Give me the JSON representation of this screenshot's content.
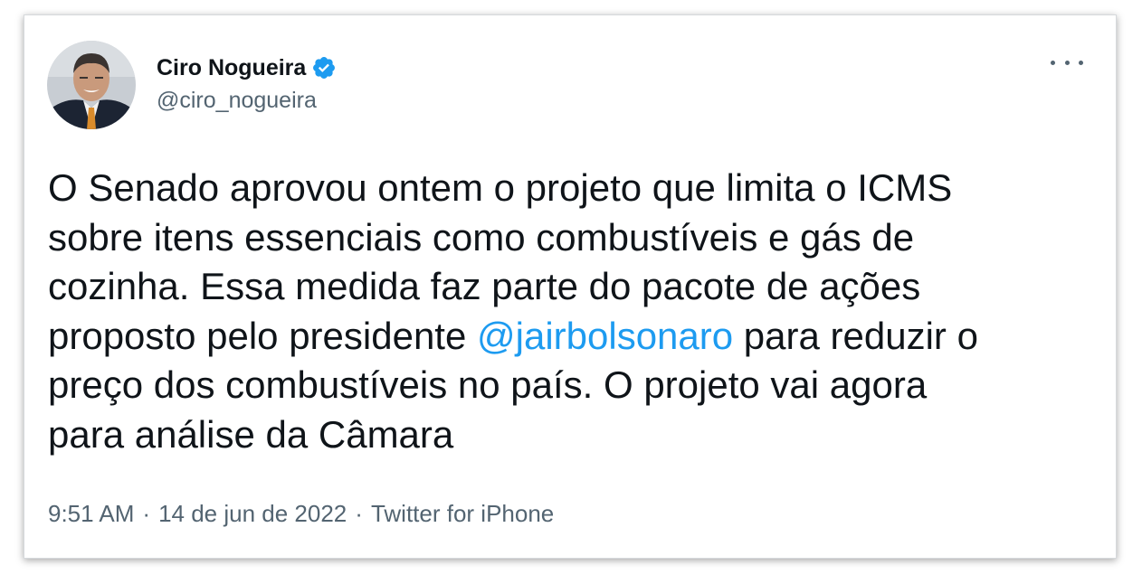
{
  "author": {
    "name": "Ciro Nogueira",
    "handle": "@ciro_nogueira",
    "verified": true,
    "avatar_icon": "profile-photo"
  },
  "tweet": {
    "lines": [
      [
        {
          "text": "O Senado aprovou ontem o projeto que limita o ICMS"
        }
      ],
      [
        {
          "text": "sobre itens essenciais como combustíveis e gás de"
        }
      ],
      [
        {
          "text": "cozinha. Essa medida faz parte do pacote de ações"
        }
      ],
      [
        {
          "text": "proposto pelo presidente "
        },
        {
          "text": "@jairbolsonaro",
          "mention": true
        },
        {
          "text": " para reduzir o"
        }
      ],
      [
        {
          "text": "preço dos combustíveis no país. O projeto vai agora"
        }
      ],
      [
        {
          "text": "para análise da Câmara"
        }
      ]
    ]
  },
  "meta": {
    "time": "9:51 AM",
    "separator": "·",
    "date": "14 de jun de 2022",
    "source": "Twitter for iPhone"
  },
  "colors": {
    "text": "#0f1419",
    "secondary": "#536471",
    "accent": "#1d9bf0"
  }
}
